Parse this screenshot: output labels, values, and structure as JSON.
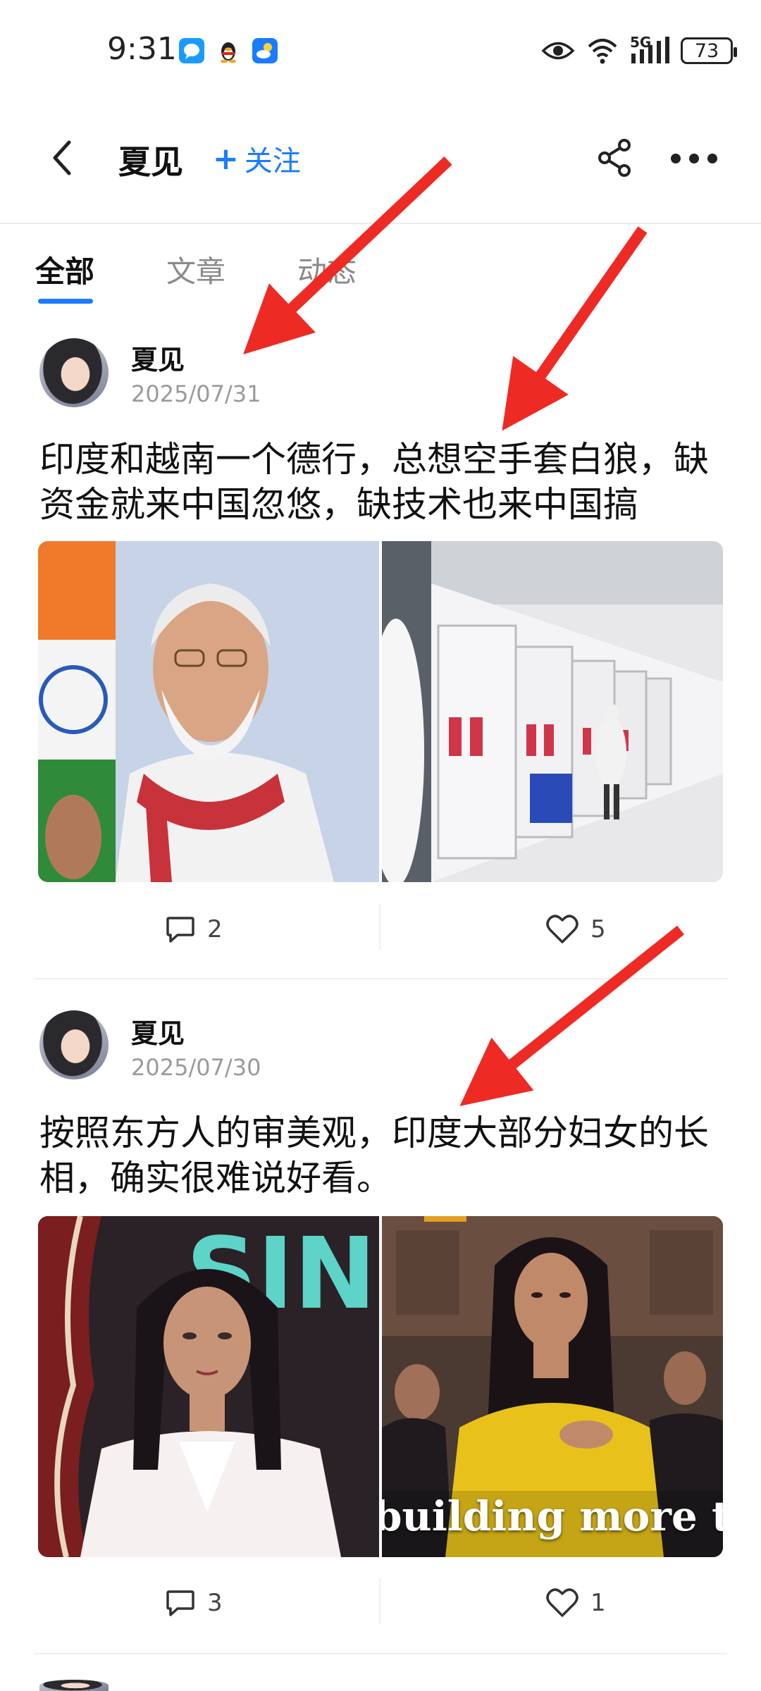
{
  "status_bar": {
    "time": "9:31",
    "network": "5G",
    "battery": "73",
    "icons": [
      "message-app-icon",
      "qq-penguin-icon",
      "weather-icon",
      "eye-icon",
      "wifi-icon",
      "signal-icon",
      "battery-icon"
    ]
  },
  "header": {
    "title": "夏见",
    "follow_plus": "+",
    "follow_label": "关注",
    "accent_color": "#1a7cff"
  },
  "tabs": [
    {
      "label": "全部",
      "active": true
    },
    {
      "label": "文章",
      "active": false
    },
    {
      "label": "动态",
      "active": false
    }
  ],
  "posts": [
    {
      "author": "夏见",
      "date": "2025/07/31",
      "text": "印度和越南一个德行，总想空手套白狼，缺资金就来中国忽悠，缺技术也来中国搞",
      "comments": "2",
      "likes": "5"
    },
    {
      "author": "夏见",
      "date": "2025/07/30",
      "text": "按照东方人的审美观，印度大部分妇女的长相，确实很难说好看。",
      "image_caption": "building more tha",
      "comments": "3",
      "likes": "1"
    }
  ]
}
